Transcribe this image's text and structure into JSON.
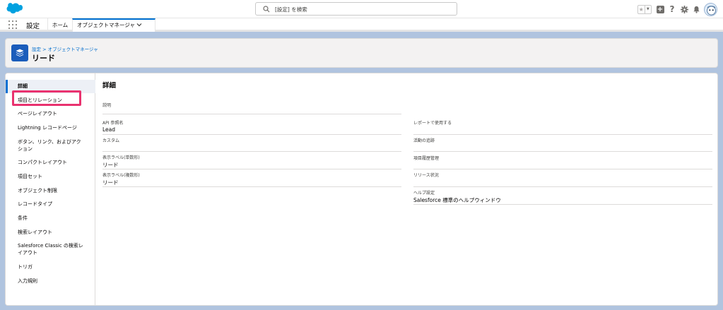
{
  "header": {
    "search_placeholder": "[設定] を検索"
  },
  "context_bar": {
    "app_name": "設定",
    "home_tab": "ホーム",
    "active_tab": "オブジェクトマネージャ"
  },
  "page_header": {
    "breadcrumb": "設定 > オブジェクトマネージャ",
    "title": "リード"
  },
  "sidebar": {
    "items": [
      {
        "label": "詳細",
        "active": true
      },
      {
        "label": "項目とリレーション",
        "highlighted": true
      },
      {
        "label": "ページレイアウト"
      },
      {
        "label": "Lightning レコードページ"
      },
      {
        "label": "ボタン、リンク、およびアクション"
      },
      {
        "label": "コンパクトレイアウト"
      },
      {
        "label": "項目セット"
      },
      {
        "label": "オブジェクト制限"
      },
      {
        "label": "レコードタイプ"
      },
      {
        "label": "条件"
      },
      {
        "label": "検索レイアウト"
      },
      {
        "label": "Salesforce Classic の検索レイアウト"
      },
      {
        "label": "トリガ"
      },
      {
        "label": "入力規則"
      }
    ]
  },
  "details": {
    "title": "詳細",
    "left": [
      {
        "label": "説明",
        "value": ""
      },
      {
        "label": "API 参照名",
        "value": "Lead"
      },
      {
        "label": "カスタム",
        "value": ""
      },
      {
        "label": "表示ラベル(単数形)",
        "value": "リード"
      },
      {
        "label": "表示ラベル(複数形)",
        "value": "リード"
      }
    ],
    "right": [
      {
        "label": "レポートで使用する",
        "value": ""
      },
      {
        "label": "活動の追跡",
        "value": ""
      },
      {
        "label": "項目履歴管理",
        "value": ""
      },
      {
        "label": "リリース状況",
        "value": ""
      },
      {
        "label": "ヘルプ設定",
        "value": "Salesforce 標準のヘルプウィンドウ"
      }
    ]
  },
  "colors": {
    "brand_blue": "#0070d2",
    "highlight_pink": "#e9326f",
    "background": "#b0c4df"
  },
  "icons": [
    "salesforce-cloud-logo",
    "search-icon",
    "star-icon",
    "chevron-down-icon",
    "plus-icon",
    "help-icon",
    "gear-icon",
    "bell-icon",
    "avatar",
    "app-launcher-icon",
    "layers-icon"
  ]
}
